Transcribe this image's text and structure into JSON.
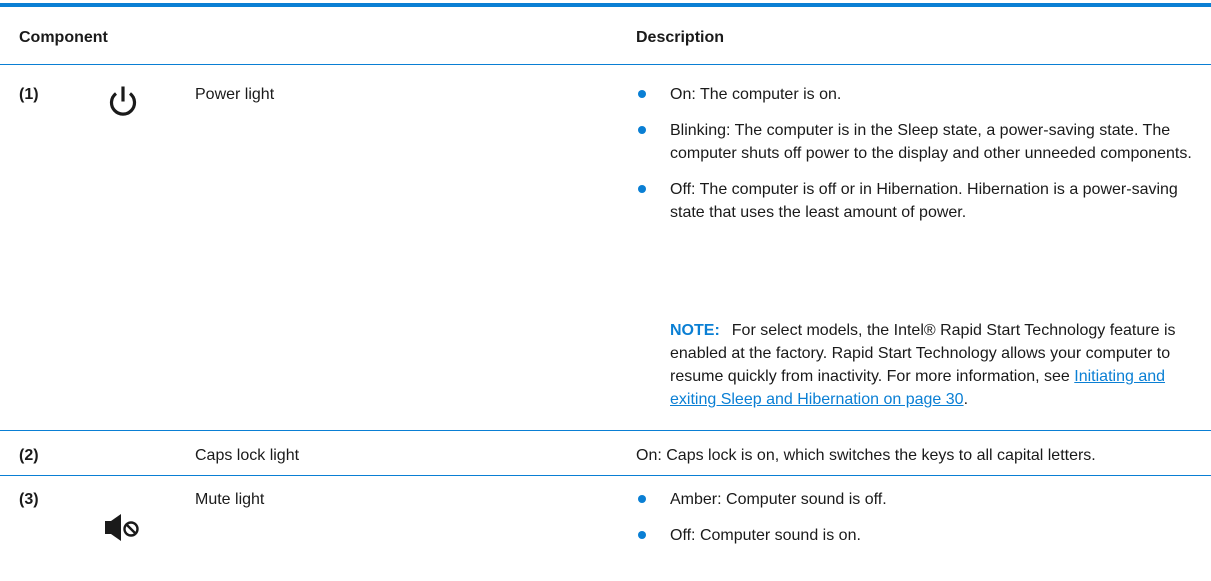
{
  "header": {
    "component_label": "Component",
    "description_label": "Description"
  },
  "rows": [
    {
      "number": "(1)",
      "icon": "power-icon",
      "name": "Power light",
      "bullets": [
        "On: The computer is on.",
        "Blinking: The computer is in the Sleep state, a power-saving state. The computer shuts off power to the display and other unneeded components.",
        "Off: The computer is off or in Hibernation. Hibernation is a power-saving state that uses the least amount of power."
      ],
      "note": {
        "label": "NOTE:",
        "text": "For select models, the Intel® Rapid Start Technology feature is enabled at the factory. Rapid Start Technology allows your computer to resume quickly from inactivity. For more information, see ",
        "link": "Initiating and exiting Sleep and Hibernation on page 30",
        "suffix": "."
      }
    },
    {
      "number": "(2)",
      "name": "Caps lock light",
      "description": "On: Caps lock is on, which switches the keys to all capital letters."
    },
    {
      "number": "(3)",
      "icon": "mute-speaker-icon",
      "name": "Mute light",
      "bullets": [
        "Amber: Computer sound is off.",
        "Off: Computer sound is on."
      ]
    }
  ],
  "colors": {
    "accent": "#0a7fd4",
    "text": "#1a1a1a"
  }
}
